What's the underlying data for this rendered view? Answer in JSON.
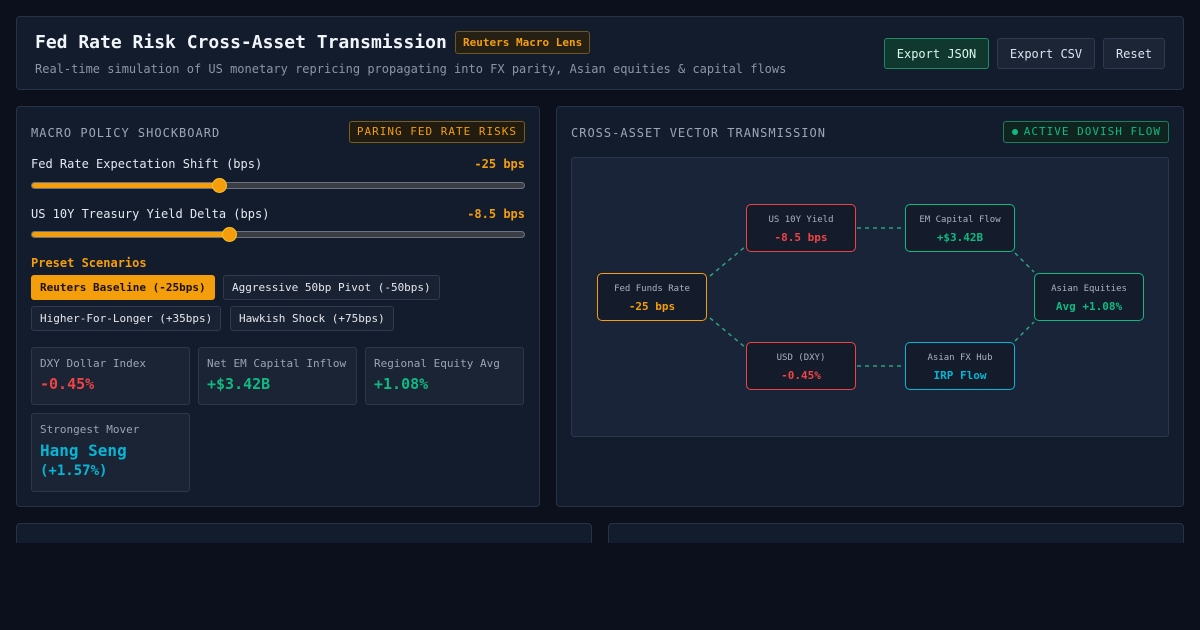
{
  "header": {
    "title": "Fed Rate Risk Cross-Asset Transmission",
    "badge": "Reuters Macro Lens",
    "subtitle": "Real-time simulation of US monetary repricing propagating into FX parity, Asian equities & capital flows",
    "buttons": {
      "export_json": "Export JSON",
      "export_csv": "Export CSV",
      "reset": "Reset"
    }
  },
  "shockboard": {
    "title": "MACRO POLICY SHOCKBOARD",
    "badge": "PARING FED RATE RISKS",
    "sliders": [
      {
        "label": "Fed Rate Expectation Shift (bps)",
        "value": "-25 bps",
        "fraction": 0.38
      },
      {
        "label": "US 10Y Treasury Yield Delta (bps)",
        "value": "-8.5 bps",
        "fraction": 0.4
      }
    ],
    "presets_title": "Preset Scenarios",
    "presets": [
      {
        "label": "Reuters Baseline (-25bps)",
        "active": true
      },
      {
        "label": "Aggressive 50bp Pivot (-50bps)",
        "active": false
      },
      {
        "label": "Higher-For-Longer (+35bps)",
        "active": false
      },
      {
        "label": "Hawkish Shock (+75bps)",
        "active": false
      }
    ],
    "stats": [
      {
        "label": "DXY Dollar Index",
        "value": "-0.45%",
        "color": "#ef4444"
      },
      {
        "label": "Net EM Capital Inflow",
        "value": "+$3.42B",
        "color": "#10b981"
      },
      {
        "label": "Regional Equity Avg",
        "value": "+1.08%",
        "color": "#10b981"
      },
      {
        "label": "Strongest Mover",
        "value": "Hang Seng",
        "value2": "(+1.57%)",
        "color": "#06b6d4"
      }
    ]
  },
  "transmission": {
    "title": "CROSS-ASSET VECTOR TRANSMISSION",
    "badge": "ACTIVE DOVISH FLOW",
    "nodes": {
      "fed": {
        "label": "Fed Funds Rate",
        "value": "-25 bps",
        "color": "#f59e0b"
      },
      "us10y": {
        "label": "US 10Y Yield",
        "value": "-8.5 bps",
        "color": "#ef4444"
      },
      "dxy": {
        "label": "USD (DXY)",
        "value": "-0.45%",
        "color": "#ef4444"
      },
      "em": {
        "label": "EM Capital Flow",
        "value": "+$3.42B",
        "color": "#10b981"
      },
      "fxhub": {
        "label": "Asian FX Hub",
        "value": "IRP Flow",
        "color": "#06b6d4"
      },
      "equities": {
        "label": "Asian Equities",
        "value": "Avg +1.08%",
        "color": "#10b981"
      }
    }
  },
  "colors": {
    "accent": "#f59e0b",
    "positive": "#10b981",
    "negative": "#ef4444",
    "cyan": "#06b6d4"
  }
}
